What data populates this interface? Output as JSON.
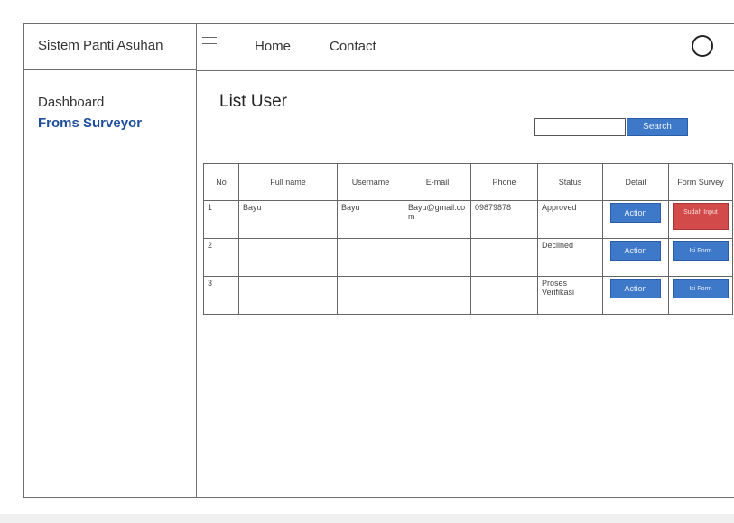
{
  "app": {
    "brand": "Sistem Panti Asuhan"
  },
  "topbar": {
    "menu_icon": "hamburger-icon",
    "nav": {
      "home": "Home",
      "contact": "Contact"
    },
    "profile_icon": "user-circle-icon"
  },
  "sidebar": {
    "items": [
      {
        "label": "Dashboard",
        "active": false
      },
      {
        "label": "Froms Surveyor",
        "active": true
      }
    ]
  },
  "main": {
    "title": "List User",
    "search": {
      "placeholder": "",
      "value": "",
      "button": "Search"
    },
    "table": {
      "headers": [
        "No",
        "Full name",
        "Username",
        "E-mail",
        "Phone",
        "Status",
        "Detail",
        "Form Survey"
      ],
      "rows": [
        {
          "no": "1",
          "fullname": "Bayu",
          "username": "Bayu",
          "email": "Bayu@gmail.com",
          "phone": "09879878",
          "status": "Approved",
          "detail": "Action",
          "form": "Sudah Input",
          "form_color": "#d34a4a"
        },
        {
          "no": "2",
          "fullname": "",
          "username": "",
          "email": "",
          "phone": "",
          "status": "Declined",
          "detail": "Action",
          "form": "Isi Form",
          "form_color": "#3d78c9"
        },
        {
          "no": "3",
          "fullname": "",
          "username": "",
          "email": "",
          "phone": "",
          "status": "Proses Verifikasi",
          "detail": "Action",
          "form": "Isi Form",
          "form_color": "#3d78c9"
        }
      ]
    }
  },
  "colors": {
    "accent": "#3d78c9",
    "danger": "#d34a4a",
    "sidebar_active": "#1f4e9c"
  }
}
